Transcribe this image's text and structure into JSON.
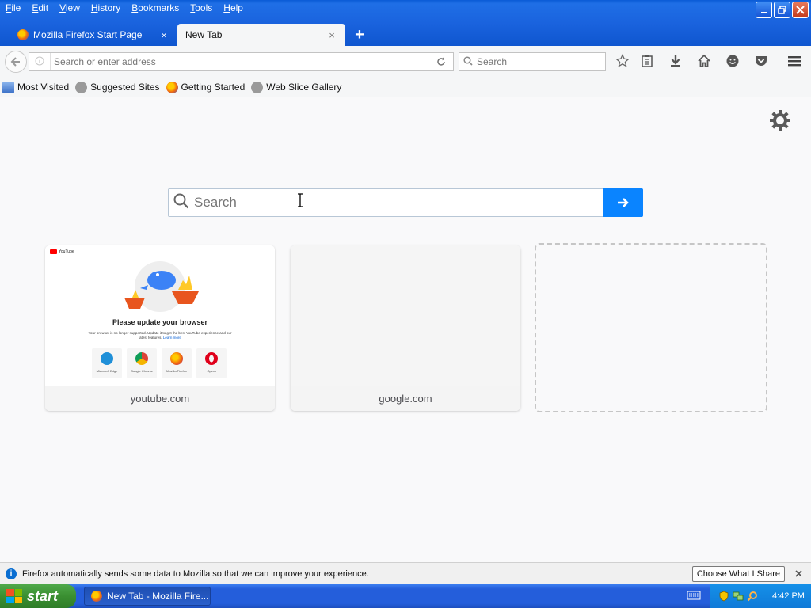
{
  "menu": [
    {
      "key": "F",
      "rest": "ile"
    },
    {
      "key": "E",
      "rest": "dit"
    },
    {
      "key": "V",
      "rest": "iew"
    },
    {
      "key": "H",
      "rest": "istory"
    },
    {
      "key": "B",
      "rest": "ookmarks"
    },
    {
      "key": "T",
      "rest": "ools"
    },
    {
      "key": "H",
      "rest": "elp"
    }
  ],
  "tabs": {
    "inactive": {
      "label": "Mozilla Firefox Start Page"
    },
    "active": {
      "label": "New Tab"
    },
    "close_glyph": "×",
    "new_tab_glyph": "+"
  },
  "nav": {
    "address_placeholder": "Search or enter address",
    "search_placeholder": "Search"
  },
  "bookmarks": [
    {
      "label": "Most Visited",
      "icon": "most-visited-icon"
    },
    {
      "label": "Suggested Sites",
      "icon": "globe-icon"
    },
    {
      "label": "Getting Started",
      "icon": "firefox-icon"
    },
    {
      "label": "Web Slice Gallery",
      "icon": "globe-icon"
    }
  ],
  "newtab": {
    "search_placeholder": "Search",
    "tiles": [
      {
        "label": "youtube.com",
        "preview": {
          "logo_text": "YouTube",
          "heading": "Please update your browser",
          "subtext": "Your browser is no longer supported. Update it to get the best YouTube experience and our latest features.",
          "learn_more": "Learn more",
          "browsers": [
            {
              "name": "Microsoft Edge",
              "color": "#1f8fd8"
            },
            {
              "name": "Google Chrome",
              "color": "#db4437"
            },
            {
              "name": "Mozilla Firefox",
              "color": "#f26a10"
            },
            {
              "name": "Opera",
              "color": "#e0001b"
            }
          ]
        }
      },
      {
        "label": "google.com"
      }
    ]
  },
  "notification": {
    "text": "Firefox automatically sends some data to Mozilla so that we can improve your experience.",
    "button": "Choose What I Share"
  },
  "taskbar": {
    "start_label": "start",
    "task_label": "New Tab - Mozilla Fire...",
    "clock": "4:42 PM"
  }
}
